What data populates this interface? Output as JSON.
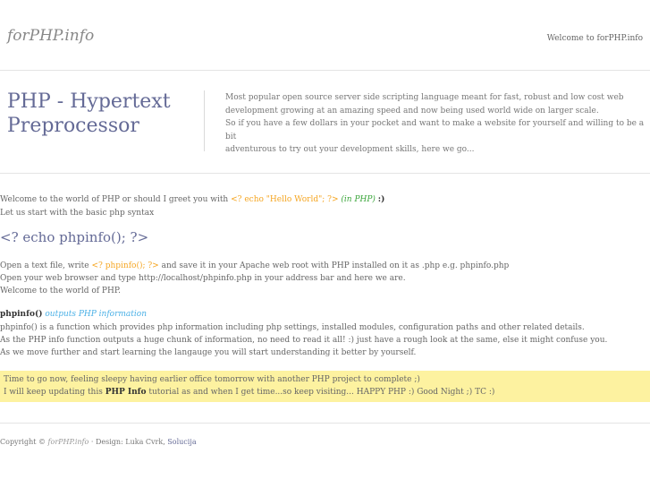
{
  "header": {
    "logo": "forPHP.info",
    "welcome": "Welcome to forPHP.info"
  },
  "hero": {
    "title_line1": "PHP - Hypertext",
    "title_line2": "Preprocessor",
    "desc_line1": "Most popular open source server side scripting language meant for fast, robust and low cost web",
    "desc_line2": "development growing at an amazing speed and now being used world wide on larger scale.",
    "desc_line3": "So if you have a few dollars in your pocket and want to make a website for yourself and willing to be a bit",
    "desc_line4": "adventurous to try out your development skills, here we go..."
  },
  "intro": {
    "line1_prefix": "Welcome to the world of PHP or should I greet you with ",
    "line1_code": "<? echo \"Hello World\"; ?>",
    "line1_lang": "(in PHP)",
    "line1_smiley": ":)",
    "line2": "Let us start with the basic php syntax"
  },
  "code_heading": "<? echo phpinfo(); ?>",
  "steps": {
    "line1_prefix": "Open a text file, write ",
    "line1_code": "<? phpinfo(); ?>",
    "line1_suffix": " and save it in your Apache web root with PHP installed on it as .php e.g. phpinfo.php",
    "line2": "Open your web browser and type http://localhost/phpinfo.php in your address bar and here we are.",
    "line3": "Welcome to the world of PHP."
  },
  "phpinfo": {
    "func": "phpinfo()",
    "link": "outputs PHP information",
    "line1": "phpinfo() is a function which provides php information including php settings, installed modules, configuration paths and other related details.",
    "line2": "As the PHP info function outputs a huge chunk of information, no need to read it all! :) just have a rough look at the same, else it might confuse you.",
    "line3": "As we move further and start learning the langauge you will start understanding it better by yourself."
  },
  "note": {
    "line1": "Time to go now, feeling sleepy having earlier office tomorrow with another PHP project to complete ;)",
    "line2_prefix": "I will keep updating this ",
    "line2_bold": "PHP Info",
    "line2_suffix": " tutorial as and when I get time...so keep visiting... HAPPY PHP :) Good Night ;) TC :)"
  },
  "footer": {
    "prefix": "Copyright © ",
    "site": "forPHP.info",
    "middle": " · Design: Luka Cvrk, ",
    "link": "Solucija"
  }
}
